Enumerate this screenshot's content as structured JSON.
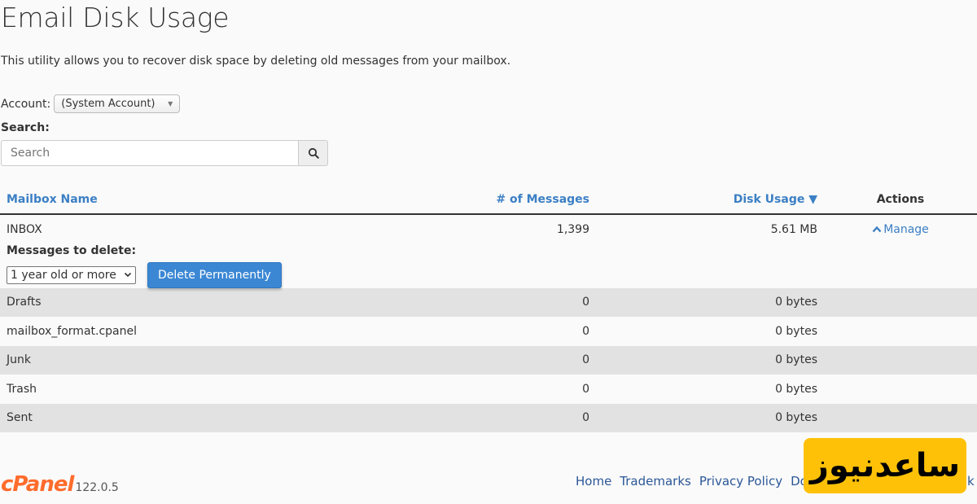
{
  "page": {
    "title": "Email Disk Usage",
    "description": "This utility allows you to recover disk space by deleting old messages from your mailbox."
  },
  "account": {
    "label": "Account:",
    "selected": "(System Account)"
  },
  "search": {
    "label": "Search:",
    "placeholder": "Search",
    "value": ""
  },
  "table": {
    "columns": {
      "name": "Mailbox Name",
      "messages": "# of Messages",
      "usage": "Disk Usage",
      "usage_sort_icon": "▼",
      "actions": "Actions"
    },
    "inbox": {
      "name": "INBOX",
      "messages": "1,399",
      "usage": "5.61 MB",
      "manage_icon": "^",
      "manage_label": "Manage"
    },
    "delete_panel": {
      "label": "Messages to delete:",
      "selected_option": "1 year old or more",
      "button_label": "Delete Permanently"
    },
    "rows": [
      {
        "name": "Drafts",
        "messages": "0",
        "usage": "0 bytes"
      },
      {
        "name": "mailbox_format.cpanel",
        "messages": "0",
        "usage": "0 bytes"
      },
      {
        "name": "Junk",
        "messages": "0",
        "usage": "0 bytes"
      },
      {
        "name": "Trash",
        "messages": "0",
        "usage": "0 bytes"
      },
      {
        "name": "Sent",
        "messages": "0",
        "usage": "0 bytes"
      }
    ]
  },
  "footer": {
    "logo": "cPanel",
    "version": "122.0.5",
    "links": [
      "Home",
      "Trademarks",
      "Privacy Policy",
      "Do"
    ],
    "trailing_text": "k"
  },
  "watermark": {
    "text": "ساعدنیوز",
    "color": "#ffc107"
  },
  "colors": {
    "link": "#3b7fc4",
    "primary_button": "#3b87d4",
    "brand": "#ff6c2c"
  }
}
